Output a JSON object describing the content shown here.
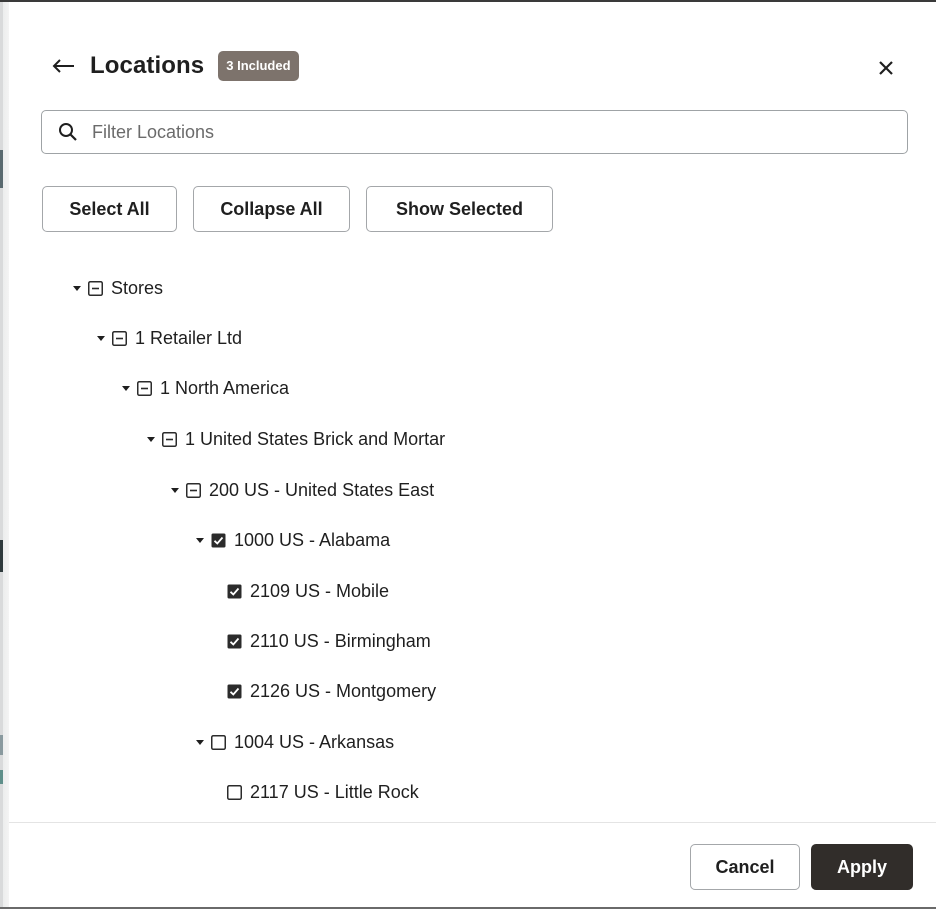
{
  "header": {
    "title": "Locations",
    "badge": "3 Included"
  },
  "search": {
    "placeholder": "Filter Locations",
    "value": ""
  },
  "toolbar": {
    "select_all": "Select All",
    "collapse_all": "Collapse All",
    "show_selected": "Show Selected"
  },
  "tree": [
    {
      "label": "Stores",
      "state": "partial",
      "expanded": true
    },
    {
      "label": "1 Retailer Ltd",
      "state": "partial",
      "expanded": true
    },
    {
      "label": "1 North America",
      "state": "partial",
      "expanded": true
    },
    {
      "label": "1 United States Brick and Mortar",
      "state": "partial",
      "expanded": true
    },
    {
      "label": "200 US - United States East",
      "state": "partial",
      "expanded": true
    },
    {
      "label": "1000 US - Alabama",
      "state": "checked",
      "expanded": true
    },
    {
      "label": "2109 US - Mobile",
      "state": "checked"
    },
    {
      "label": "2110 US - Birmingham",
      "state": "checked"
    },
    {
      "label": "2126 US - Montgomery",
      "state": "checked"
    },
    {
      "label": "1004 US - Arkansas",
      "state": "unchecked",
      "expanded": true
    },
    {
      "label": "2117 US - Little Rock",
      "state": "unchecked"
    }
  ],
  "footer": {
    "cancel": "Cancel",
    "apply": "Apply"
  },
  "colors": {
    "badge_bg": "#7d736c",
    "primary_button_bg": "#312d2a",
    "checkbox_fill": "#2b2b2b",
    "border": "#a4a7aa"
  }
}
